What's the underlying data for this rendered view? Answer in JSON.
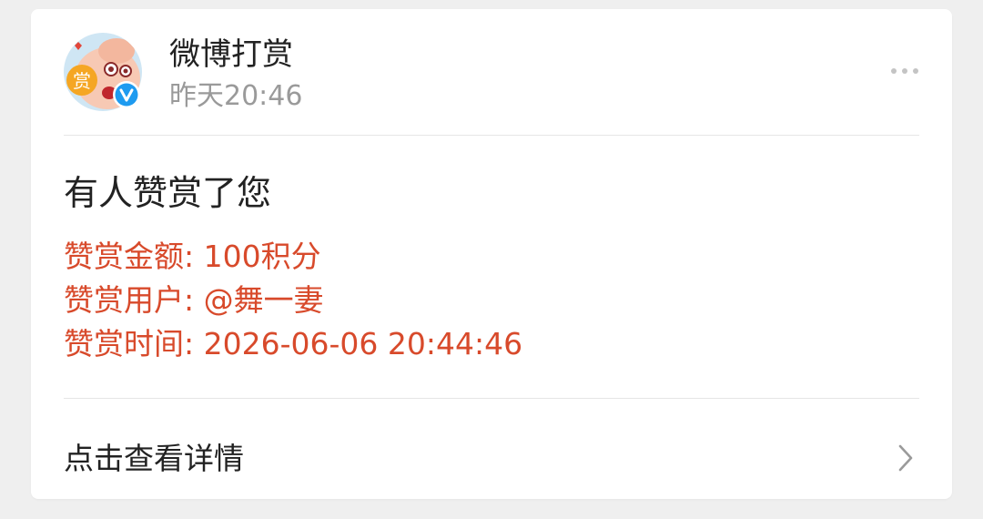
{
  "sender": {
    "name": "微博打赏",
    "time": "昨天20:46",
    "avatar_badge_text": "赏"
  },
  "message": {
    "title": "有人赞赏了您",
    "details": [
      "赞赏金额: 100积分",
      "赞赏用户: @舞一妻",
      "赞赏时间: 2026-06-06 20:44:46"
    ]
  },
  "footer": {
    "link_label": "点击查看详情"
  },
  "icons": {
    "more": "more-dots-icon",
    "chevron": "chevron-right-icon",
    "verified": "verified-badge-icon"
  },
  "colors": {
    "accent_red": "#d84a2b",
    "verified_blue": "#1e9bf0",
    "badge_orange": "#f5a623"
  }
}
